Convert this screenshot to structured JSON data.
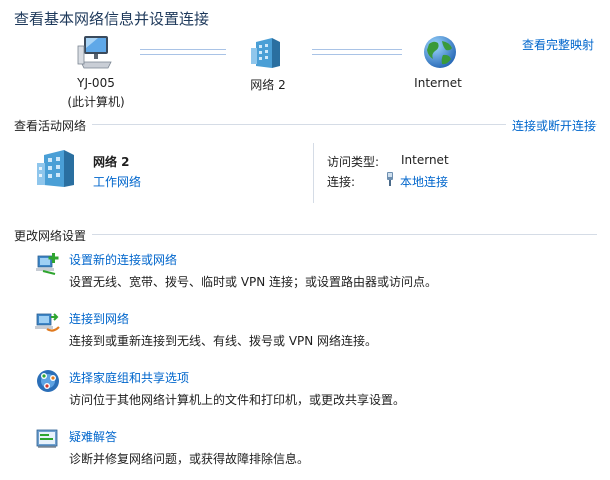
{
  "header": {
    "title": "查看基本网络信息并设置连接",
    "full_map_link": "查看完整映射"
  },
  "network_map": {
    "computer": {
      "icon": "computer-icon",
      "name": "YJ-005",
      "subtitle": "(此计算机)"
    },
    "network": {
      "icon": "network-icon",
      "name": "网络 2"
    },
    "internet": {
      "icon": "globe-icon",
      "name": "Internet"
    }
  },
  "active_networks": {
    "section_title": "查看活动网络",
    "connect_disconnect_link": "连接或断开连接",
    "network": {
      "icon": "network-building-icon",
      "name": "网络 2",
      "type_link": "工作网络",
      "access_type_label": "访问类型:",
      "access_type_value": "Internet",
      "connection_label": "连接:",
      "connection_icon": "adapter-icon",
      "connection_link": "本地连接"
    }
  },
  "change_settings": {
    "section_title": "更改网络设置",
    "tasks": [
      {
        "icon": "new-connection-icon",
        "title": "设置新的连接或网络",
        "description": "设置无线、宽带、拨号、临时或 VPN 连接；或设置路由器或访问点。"
      },
      {
        "icon": "connect-network-icon",
        "title": "连接到网络",
        "description": "连接到或重新连接到无线、有线、拨号或 VPN 网络连接。"
      },
      {
        "icon": "homegroup-icon",
        "title": "选择家庭组和共享选项",
        "description": "访问位于其他网络计算机上的文件和打印机，或更改共享设置。"
      },
      {
        "icon": "troubleshoot-icon",
        "title": "疑难解答",
        "description": "诊断并修复网络问题，或获得故障排除信息。"
      }
    ]
  },
  "colors": {
    "link": "#0066cc",
    "title": "#1e395b",
    "rule": "#d5dce6"
  }
}
